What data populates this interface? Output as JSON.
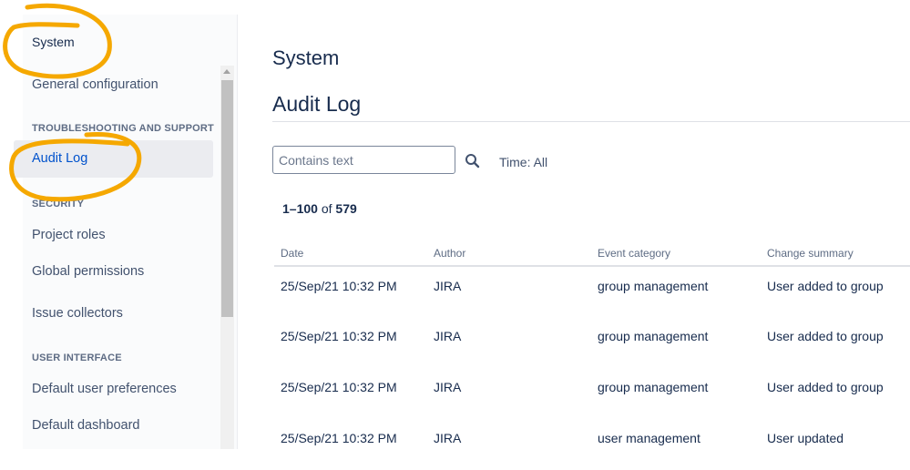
{
  "sidebar": {
    "title": "System",
    "items": [
      {
        "label": "General configuration"
      },
      {
        "section": "TROUBLESHOOTING AND SUPPORT"
      },
      {
        "label": "Audit Log",
        "active": true
      },
      {
        "section": "SECURITY"
      },
      {
        "label": "Project roles"
      },
      {
        "label": "Global permissions"
      },
      {
        "label": "Issue collectors"
      },
      {
        "section": "USER INTERFACE"
      },
      {
        "label": "Default user preferences"
      },
      {
        "label": "Default dashboard"
      }
    ]
  },
  "main": {
    "title": "System",
    "subtitle": "Audit Log",
    "search": {
      "placeholder": "Contains text",
      "value": ""
    },
    "time_filter": "Time: All",
    "count": {
      "range": "1–100",
      "of": "of",
      "total": "579"
    },
    "columns": [
      "Date",
      "Author",
      "Event category",
      "Change summary"
    ],
    "rows": [
      [
        "25/Sep/21 10:32 PM",
        "JIRA",
        "group management",
        "User added to group"
      ],
      [
        "25/Sep/21 10:32 PM",
        "JIRA",
        "group management",
        "User added to group"
      ],
      [
        "25/Sep/21 10:32 PM",
        "JIRA",
        "group management",
        "User added to group"
      ],
      [
        "25/Sep/21 10:32 PM",
        "JIRA",
        "user management",
        "User updated"
      ]
    ]
  },
  "colors": {
    "accent": "#0052cc",
    "annotation": "#f5a800"
  }
}
